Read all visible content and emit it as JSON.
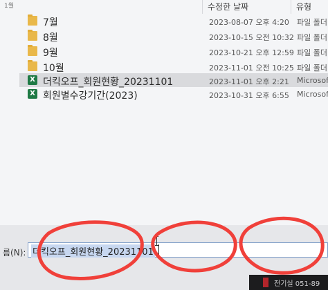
{
  "header": {
    "name_fragment": "1월",
    "date_column": "수정한 날짜",
    "type_column": "유형"
  },
  "files": [
    {
      "name": "7월",
      "icon": "folder-icon",
      "date": "2023-08-07 오후 4:20",
      "type": "파일 폴더",
      "selected": false
    },
    {
      "name": "8월",
      "icon": "folder-icon",
      "date": "2023-10-15 오전 10:32",
      "type": "파일 폴더",
      "selected": false
    },
    {
      "name": "9월",
      "icon": "folder-icon",
      "date": "2023-10-21 오후 12:59",
      "type": "파일 폴더",
      "selected": false
    },
    {
      "name": "10월",
      "icon": "folder-icon",
      "date": "2023-11-01 오전 10:25",
      "type": "파일 폴더",
      "selected": false
    },
    {
      "name": "더킥오프_회원현황_20231101",
      "icon": "excel-icon",
      "date": "2023-11-01 오후 2:21",
      "type": "Microsoft",
      "selected": true
    },
    {
      "name": "회원별수강기간(2023)",
      "icon": "excel-icon",
      "date": "2023-10-31 오후 6:55",
      "type": "Microsoft",
      "selected": false
    }
  ],
  "filename_field": {
    "label": "름(N):",
    "value": "더킥오프_회원현황_20231101"
  },
  "taskbar": {
    "text": "전기실 051-89"
  },
  "colors": {
    "annotation_red": "#f0403a",
    "selection": "#d9dadd",
    "excel_green": "#1f7a45",
    "folder_yellow": "#e9b84a"
  }
}
